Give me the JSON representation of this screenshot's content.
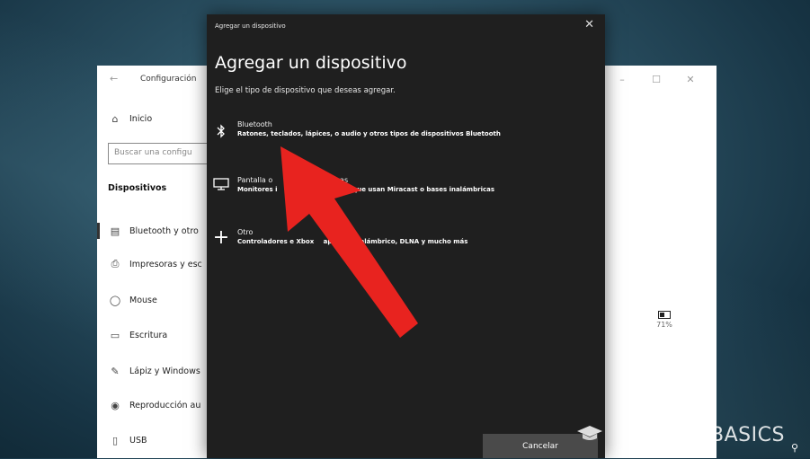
{
  "settings": {
    "title": "Configuración",
    "window_controls": [
      "–",
      "☐",
      "✕"
    ],
    "home_label": "Inicio",
    "search_placeholder": "Buscar una configu",
    "section_heading": "Dispositivos",
    "nav_items": [
      {
        "label": "Bluetooth y otro",
        "icon": "bluetooth-devices-icon"
      },
      {
        "label": "Impresoras y esc",
        "icon": "printer-icon"
      },
      {
        "label": "Mouse",
        "icon": "mouse-icon"
      },
      {
        "label": "Escritura",
        "icon": "keyboard-icon"
      },
      {
        "label": "Lápiz y Windows",
        "icon": "pen-icon"
      },
      {
        "label": "Reproducción au",
        "icon": "autoplay-icon"
      },
      {
        "label": "USB",
        "icon": "usb-icon"
      }
    ],
    "battery_percent": "71%"
  },
  "dialog": {
    "titlebar": "Agregar un dispositivo",
    "close": "✕",
    "heading": "Agregar un dispositivo",
    "subtitle": "Elige el tipo de dispositivo que deseas agregar.",
    "options": [
      {
        "title": "Bluetooth",
        "description": "Ratones, teclados, lápices, o audio y otros tipos de dispositivos Bluetooth",
        "icon": "bluetooth-icon"
      },
      {
        "title": "Pantalla o",
        "title_tail": "mbricas",
        "description": "Monitores i",
        "description_tail": "ores o PCs que usan Miracast o bases inalámbricas",
        "icon": "monitor-icon"
      },
      {
        "title": "Otro",
        "description": "Controladores",
        "description_mid": "e Xbox",
        "description_tail": "aptador inalámbrico, DLNA y mucho más",
        "icon": "plus-icon"
      }
    ],
    "cancel_label": "Cancelar"
  },
  "overlay": {
    "watermark": "BASICS",
    "arrow_color": "#e8231f"
  }
}
